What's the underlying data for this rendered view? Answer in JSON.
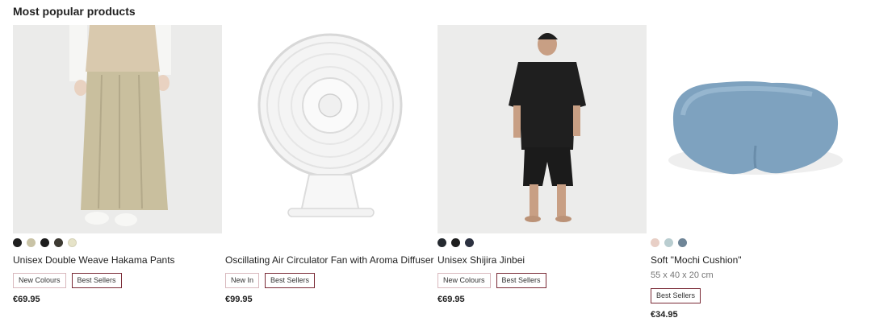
{
  "section": {
    "title": "Most popular products"
  },
  "products": [
    {
      "name": "Unisex Double Weave Hakama Pants",
      "image_icon": "hakama-pants-photo",
      "swatches": [
        "#1f1f1f",
        "#c9c3a6",
        "#1c1c1c",
        "#3d3a33",
        "#e6e3c8"
      ],
      "badges": [
        {
          "label": "New Colours",
          "type": "new"
        },
        {
          "label": "Best Sellers",
          "type": "best"
        }
      ],
      "price": "€69.95"
    },
    {
      "name": "Oscillating Air Circulator Fan with Aroma Diffuser",
      "image_icon": "fan-photo",
      "swatches": [],
      "badges": [
        {
          "label": "New In",
          "type": "new"
        },
        {
          "label": "Best Sellers",
          "type": "best"
        }
      ],
      "price": "€99.95"
    },
    {
      "name": "Unisex Shijira Jinbei",
      "image_icon": "jinbei-photo",
      "swatches": [
        "#252a30",
        "#1e1e1e",
        "#2c3140"
      ],
      "badges": [
        {
          "label": "New Colours",
          "type": "new"
        },
        {
          "label": "Best Sellers",
          "type": "best"
        }
      ],
      "price": "€69.95"
    },
    {
      "name": "Soft \"Mochi Cushion\"",
      "image_icon": "cushion-photo",
      "dimensions": "55 x 40 x 20 cm",
      "swatches": [
        "#e8cfc6",
        "#b9cdd0",
        "#6f8597"
      ],
      "badges": [
        {
          "label": "Best Sellers",
          "type": "best"
        }
      ],
      "price": "€34.95"
    }
  ]
}
